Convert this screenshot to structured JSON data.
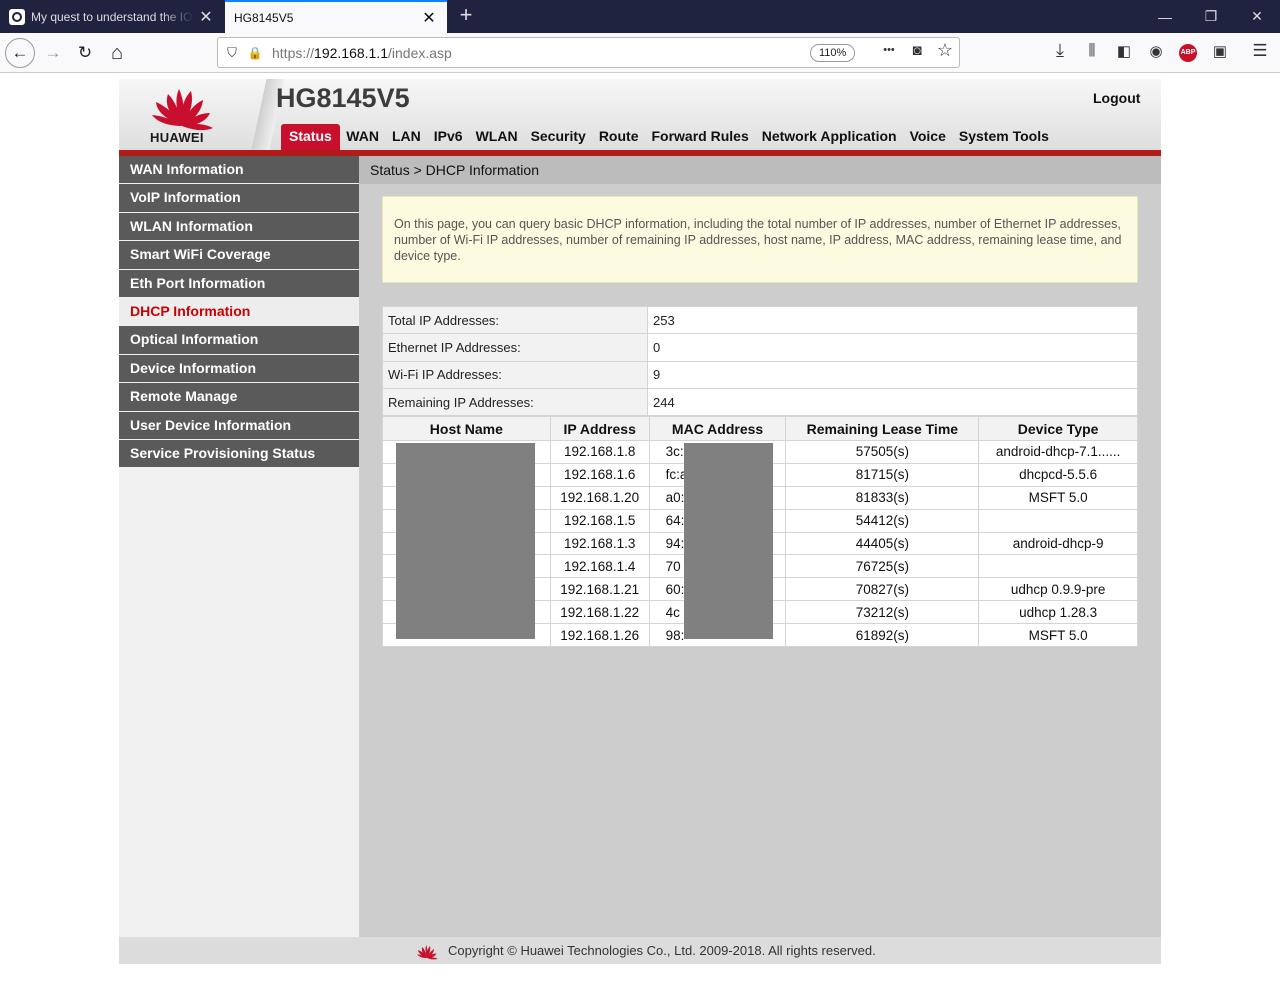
{
  "browser": {
    "tabs": [
      {
        "title": "My quest to understand the IOT",
        "active": false
      },
      {
        "title": "HG8145V5",
        "active": true
      }
    ],
    "url_scheme": "https://",
    "url_host": "192.168.1.1",
    "url_path": "/index.asp",
    "zoom": "110%",
    "icons": {
      "back": "←",
      "forward": "→",
      "reload": "↻",
      "home": "⌂",
      "shield": "⛉",
      "lock": "🔒",
      "more": "•••",
      "pocket": "◙",
      "star": "☆",
      "download": "⤓",
      "library": "⫼",
      "sidebar": "◧",
      "account": "◉",
      "abp": "ABP",
      "screenshot": "▣",
      "menu": "☰",
      "close": "✕",
      "newtab": "+",
      "minimize": "—",
      "restore": "❐"
    }
  },
  "router": {
    "brand": "HUAWEI",
    "model": "HG8145V5",
    "logout": "Logout",
    "brand_color": "#c8102e",
    "menu": [
      "Status",
      "WAN",
      "LAN",
      "IPv6",
      "WLAN",
      "Security",
      "Route",
      "Forward Rules",
      "Network Application",
      "Voice",
      "System Tools"
    ],
    "active_menu": "Status",
    "sidebar": [
      "WAN Information",
      "VoIP Information",
      "WLAN Information",
      "Smart WiFi Coverage",
      "Eth Port Information",
      "DHCP Information",
      "Optical Information",
      "Device Information",
      "Remote Manage",
      "User Device Information",
      "Service Provisioning Status"
    ],
    "active_sidebar": "DHCP Information",
    "breadcrumb": "Status > DHCP Information",
    "description": "On this page, you can query basic DHCP information, including the total number of IP addresses, number of Ethernet IP addresses, number of Wi-Fi IP addresses, number of remaining IP addresses, host name, IP address, MAC address, remaining lease time, and device type.",
    "summary": [
      {
        "label": "Total IP Addresses:",
        "value": "253"
      },
      {
        "label": "Ethernet IP Addresses:",
        "value": "0"
      },
      {
        "label": "Wi-Fi IP Addresses:",
        "value": "9"
      },
      {
        "label": "Remaining IP Addresses:",
        "value": "244"
      }
    ],
    "table_headers": [
      "Host Name",
      "IP Address",
      "MAC Address",
      "Remaining Lease Time",
      "Device Type"
    ],
    "table_rows": [
      {
        "host": "",
        "ip": "192.168.1.8",
        "mac": "3c:",
        "lease": "57505(s)",
        "type": "android-dhcp-7.1......"
      },
      {
        "host": "",
        "ip": "192.168.1.6",
        "mac": "fc:a",
        "lease": "81715(s)",
        "type": "dhcpcd-5.5.6"
      },
      {
        "host": "",
        "ip": "192.168.1.20",
        "mac": "a0:",
        "lease": "81833(s)",
        "type": "MSFT 5.0"
      },
      {
        "host": "",
        "ip": "192.168.1.5",
        "mac": "64:",
        "lease": "54412(s)",
        "type": ""
      },
      {
        "host": "",
        "ip": "192.168.1.3",
        "mac": "94:",
        "lease": "44405(s)",
        "type": "android-dhcp-9"
      },
      {
        "host": "",
        "ip": "192.168.1.4",
        "mac": "70",
        "lease": "76725(s)",
        "type": ""
      },
      {
        "host": "",
        "ip": "192.168.1.21",
        "mac": "60:",
        "lease": "70827(s)",
        "type": "udhcp 0.9.9-pre"
      },
      {
        "host": "",
        "ip": "192.168.1.22",
        "mac": "4c",
        "lease": "73212(s)",
        "type": "udhcp 1.28.3"
      },
      {
        "host": "",
        "ip": "192.168.1.26",
        "mac": "98:",
        "lease": "61892(s)",
        "type": "MSFT 5.0"
      }
    ],
    "footer": "Copyright © Huawei Technologies Co., Ltd. 2009-2018. All rights reserved."
  }
}
